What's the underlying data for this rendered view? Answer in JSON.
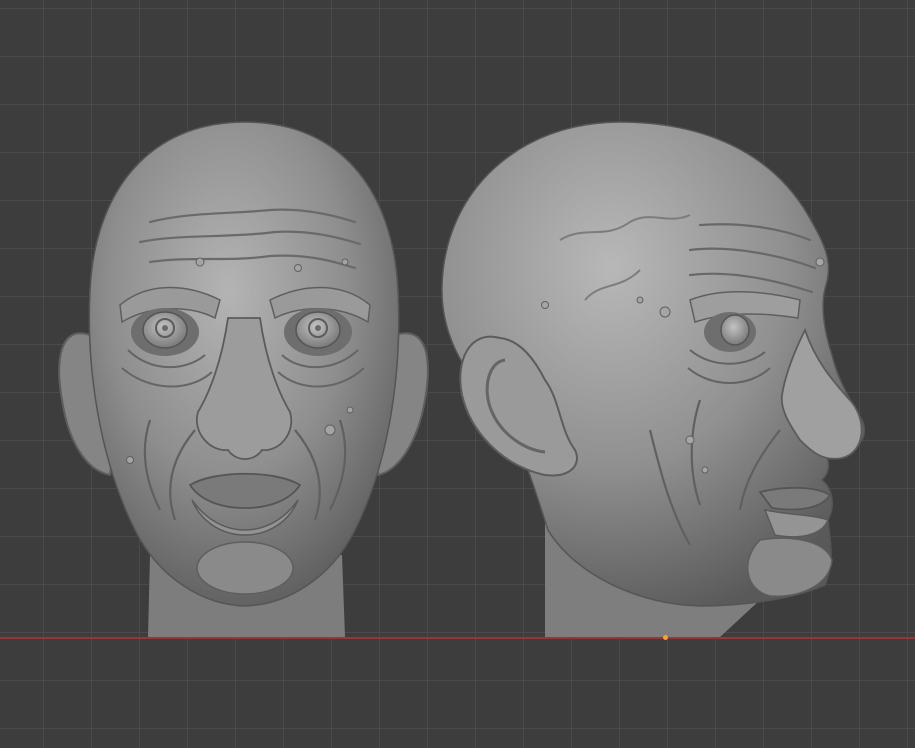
{
  "viewport": {
    "background_color": "#3d3d3d",
    "grid_color": "#4a4a4a",
    "x_axis_color": "#8e3a3a",
    "origin_marker_color": "#f2a23a",
    "model_color": "#8d8d8d"
  },
  "objects": [
    {
      "name": "head-front-view"
    },
    {
      "name": "head-side-view"
    }
  ]
}
